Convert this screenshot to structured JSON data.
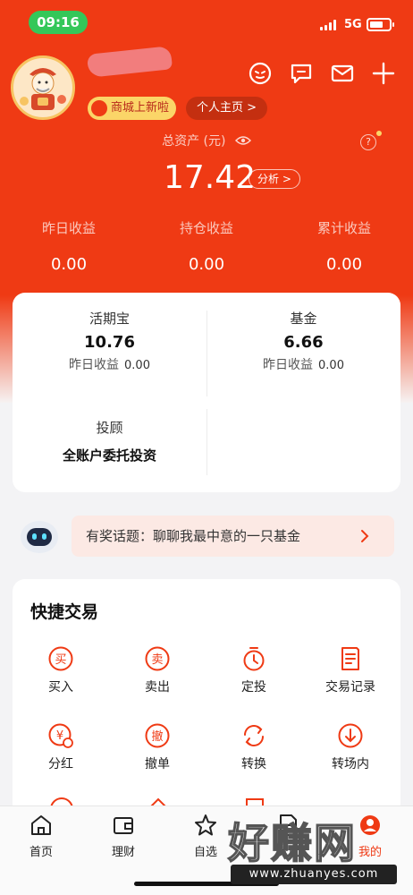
{
  "status_bar": {
    "time": "09:16",
    "network": "5G"
  },
  "profile": {
    "mall_badge": "商城上新啦",
    "home_button": "个人主页 >"
  },
  "assets": {
    "label": "总资产 (元)",
    "total": "17.42",
    "analyze": "分析 >",
    "stats": [
      {
        "label": "昨日收益",
        "value": "0.00"
      },
      {
        "label": "持仓收益",
        "value": "0.00"
      },
      {
        "label": "累计收益",
        "value": "0.00"
      }
    ]
  },
  "holdings": {
    "huoqibao": {
      "name": "活期宝",
      "amount": "10.76",
      "sub_label": "昨日收益",
      "sub_value": "0.00"
    },
    "fund": {
      "name": "基金",
      "amount": "6.66",
      "sub_label": "昨日收益",
      "sub_value": "0.00"
    },
    "advisor": {
      "name": "投顾",
      "desc": "全账户委托投资"
    }
  },
  "topic": {
    "text": "有奖话题：聊聊我最中意的一只基金"
  },
  "quick_trade": {
    "title": "快捷交易",
    "items": [
      {
        "label": "买入",
        "icon": "buy-icon",
        "glyph": "买"
      },
      {
        "label": "卖出",
        "icon": "sell-icon",
        "glyph": "卖"
      },
      {
        "label": "定投",
        "icon": "timer-icon"
      },
      {
        "label": "交易记录",
        "icon": "records-icon"
      },
      {
        "label": "分红",
        "icon": "dividend-icon",
        "glyph": "¥"
      },
      {
        "label": "撤单",
        "icon": "cancel-order-icon",
        "glyph": "撤"
      },
      {
        "label": "转换",
        "icon": "convert-icon"
      },
      {
        "label": "转场内",
        "icon": "transfer-in-icon"
      }
    ]
  },
  "tabs": [
    {
      "label": "首页",
      "icon": "home-icon"
    },
    {
      "label": "理财",
      "icon": "wallet-icon"
    },
    {
      "label": "自选",
      "icon": "star-icon"
    },
    {
      "label": "资讯",
      "icon": "news-icon"
    },
    {
      "label": "我的",
      "icon": "profile-icon"
    }
  ],
  "watermark": {
    "text": "好赚网",
    "url": "www.zhuanyes.com"
  },
  "colors": {
    "brand_red": "#ef3a14",
    "badge_yellow": "#fbd568",
    "status_green": "#34c759"
  }
}
